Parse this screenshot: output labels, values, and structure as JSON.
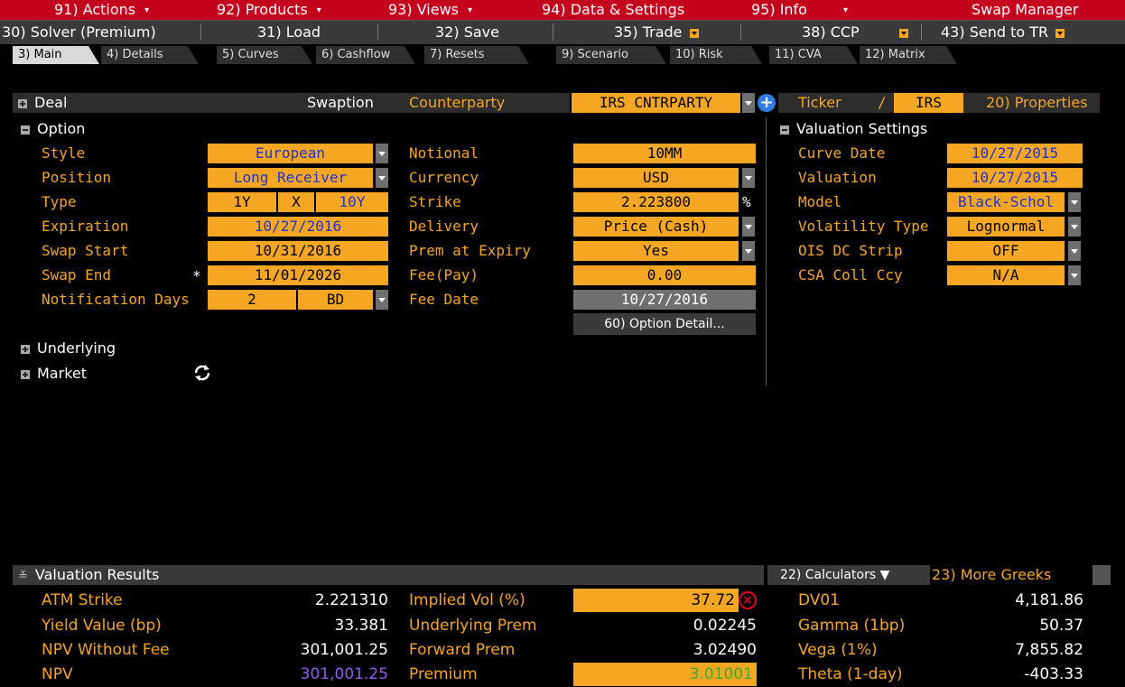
{
  "menu": {
    "actions": "91) Actions",
    "products": "92) Products",
    "views": "93) Views",
    "data_settings": "94) Data & Settings",
    "info": "95) Info",
    "app_title": "Swap Manager"
  },
  "toolbar": {
    "solver": "30) Solver (Premium)",
    "load": "31) Load",
    "save": "32) Save",
    "trade": "35) Trade",
    "ccp": "38) CCP",
    "send_tr": "43) Send to TR"
  },
  "tabs": [
    "3) Main",
    "4) Details",
    "5) Curves",
    "6) Cashflow",
    "7) Resets",
    "9) Scenario",
    "10) Risk",
    "11) CVA",
    "12) Matrix"
  ],
  "deal": {
    "label": "Deal",
    "type": "Swaption",
    "counterparty_label": "Counterparty",
    "counterparty": "IRS CNTRPARTY",
    "ticker_label": "Ticker",
    "ticker_sep": "/",
    "ticker": "IRS",
    "properties": "20) Properties"
  },
  "option": {
    "title": "Option",
    "style_label": "Style",
    "style": "European",
    "position_label": "Position",
    "position": "Long Receiver",
    "type_label": "Type",
    "type_a": "1Y",
    "type_x": "X",
    "type_b": "10Y",
    "expiration_label": "Expiration",
    "expiration": "10/27/2016",
    "swap_start_label": "Swap Start",
    "swap_start": "10/31/2016",
    "swap_end_label": "Swap End",
    "swap_end_marker": "*",
    "swap_end": "11/01/2026",
    "notif_label": "Notification Days",
    "notif_days": "2",
    "notif_unit": "BD",
    "notional_label": "Notional",
    "notional": "10MM",
    "currency_label": "Currency",
    "currency": "USD",
    "strike_label": "Strike",
    "strike": "2.223800",
    "strike_unit": "%",
    "delivery_label": "Delivery",
    "delivery": "Price (Cash)",
    "prem_expiry_label": "Prem at Expiry",
    "prem_expiry": "Yes",
    "fee_label": "Fee(Pay)",
    "fee": "0.00",
    "fee_date_label": "Fee Date",
    "fee_date": "10/27/2016",
    "option_detail": "60) Option Detail..."
  },
  "valuation_settings": {
    "title": "Valuation Settings",
    "curve_date_label": "Curve Date",
    "curve_date": "10/27/2015",
    "valuation_label": "Valuation",
    "valuation": "10/27/2015",
    "model_label": "Model",
    "model": "Black-Schol",
    "vol_type_label": "Volatility Type",
    "vol_type": "Lognormal",
    "ois_label": "OIS DC Strip",
    "ois": "OFF",
    "csa_label": "CSA Coll Ccy",
    "csa": "N/A"
  },
  "sections": {
    "underlying": "Underlying",
    "market": "Market"
  },
  "results": {
    "title": "Valuation Results",
    "calculators": "22) Calculators ▼",
    "more_greeks": "23) More Greeks",
    "atm_strike_label": "ATM Strike",
    "atm_strike": "2.221310",
    "yield_value_label": "Yield Value (bp)",
    "yield_value": "33.381",
    "npv_wo_fee_label": "NPV Without Fee",
    "npv_wo_fee": "301,001.25",
    "npv_label": "NPV",
    "npv": "301,001.25",
    "implied_vol_label": "Implied Vol (%)",
    "implied_vol": "37.72",
    "underlying_prem_label": "Underlying Prem",
    "underlying_prem": "0.02245",
    "forward_prem_label": "Forward Prem",
    "forward_prem": "3.02490",
    "premium_label": "Premium",
    "premium": "3.01001",
    "dv01_label": "DV01",
    "dv01": "4,181.86",
    "gamma_label": "Gamma (1bp)",
    "gamma": "50.37",
    "vega_label": "Vega (1%)",
    "vega": "7,855.82",
    "theta_label": "Theta (1-day)",
    "theta": "-403.33"
  },
  "colors": {
    "menu_red": "#c4001c",
    "amber": "#f5a623",
    "purple_npv": "#8f5cf0",
    "green_prem": "#3faa2e",
    "blue_text": "#2233cc"
  }
}
